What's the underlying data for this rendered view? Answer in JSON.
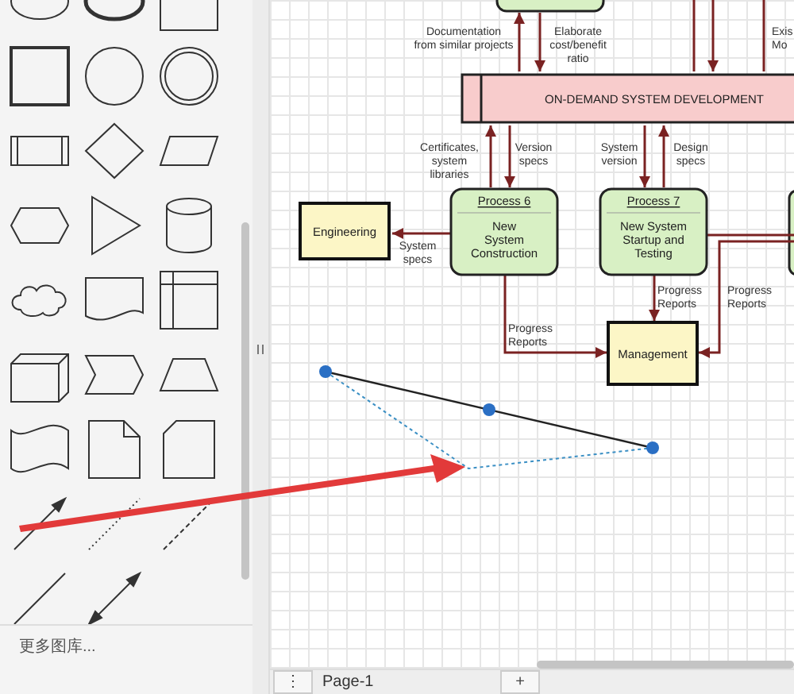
{
  "sidebar": {
    "more_shapes": "更多图库..."
  },
  "diagram": {
    "bar": {
      "title": "ON-DEMAND SYSTEM DEVELOPMENT"
    },
    "nodes": [
      {
        "kind": "entity",
        "lines": [
          "Engineering"
        ]
      },
      {
        "kind": "process",
        "title": "Process 6",
        "lines": [
          "New",
          "System",
          "Construction"
        ]
      },
      {
        "kind": "process",
        "title": "Process 7",
        "lines": [
          "New System",
          "Startup and",
          "Testing"
        ]
      },
      {
        "kind": "entity",
        "lines": [
          "Management"
        ]
      }
    ],
    "labels": [
      {
        "lines": [
          "Documentation",
          "from similar projects"
        ]
      },
      {
        "lines": [
          "Elaborate",
          "cost/benefit",
          "ratio"
        ]
      },
      {
        "lines": [
          "Exis",
          "Mo"
        ]
      },
      {
        "lines": [
          "Certificates,",
          "system",
          "libraries"
        ]
      },
      {
        "lines": [
          "Version",
          "specs"
        ]
      },
      {
        "lines": [
          "System",
          "version"
        ]
      },
      {
        "lines": [
          "Design",
          "specs"
        ]
      },
      {
        "lines": [
          "System",
          "specs"
        ]
      },
      {
        "lines": [
          "Progress",
          "Reports"
        ]
      },
      {
        "lines": [
          "Progress",
          "Reports"
        ]
      },
      {
        "lines": [
          "Progress",
          "Reports"
        ]
      }
    ]
  },
  "page_bar": {
    "menu_button": "⋮",
    "page_tab": "Page-1",
    "add_button": "+"
  }
}
